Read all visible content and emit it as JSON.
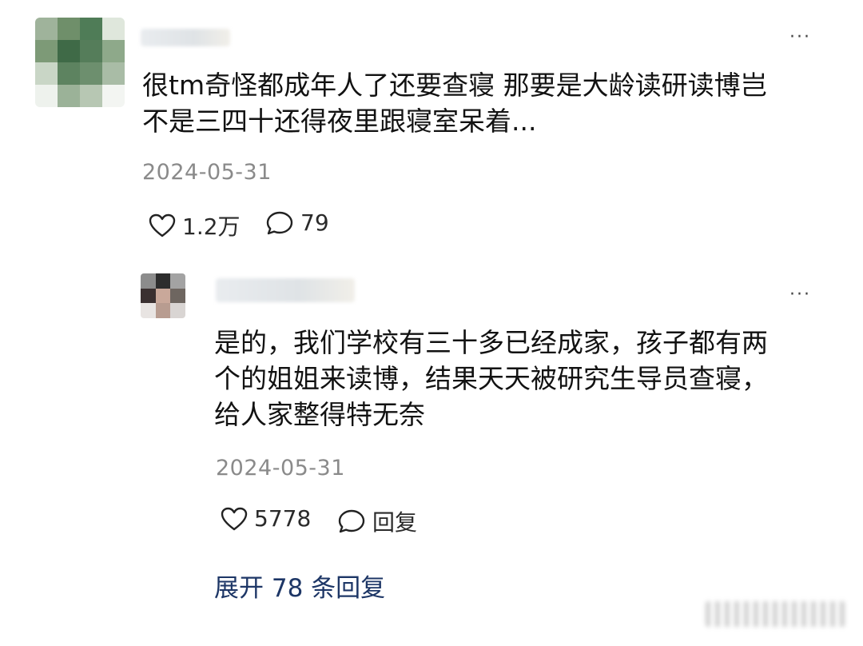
{
  "comment": {
    "text_line1": "很tm奇怪都成年人了还要查寝 那要是大龄读研读博岂",
    "text_line2": "不是三四十还得夜里跟寝室呆着...",
    "date": "2024-05-31",
    "likes": "1.2万",
    "replies": "79"
  },
  "reply": {
    "text_line1": "是的，我们学校有三十多已经成家，孩子都有两",
    "text_line2": "个的姐姐来读博，结果天天被研究生导员查寝，",
    "text_line3": "给人家整得特无奈",
    "date": "2024-05-31",
    "likes": "5778",
    "reply_label": "回复"
  },
  "expand_label": "展开 78 条回复",
  "more_glyph": "···",
  "icons": [
    "heart-icon",
    "comment-icon",
    "more-icon"
  ]
}
